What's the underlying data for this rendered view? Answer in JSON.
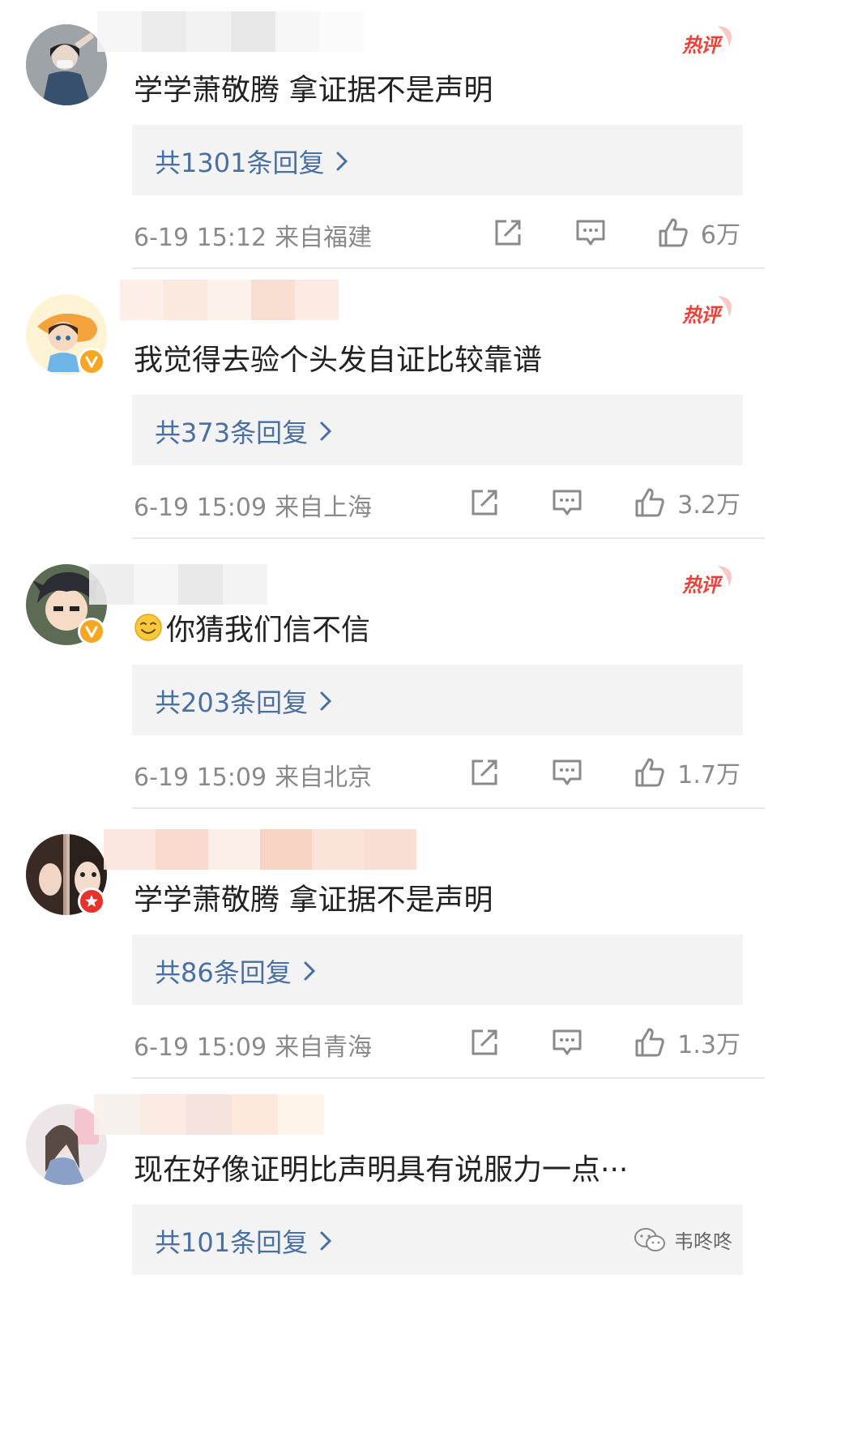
{
  "comments": [
    {
      "text": "学学萧敬腾 拿证据不是声明",
      "hot_label": "热评",
      "reply_label": "共1301条回复",
      "time": "6-19 15:12",
      "location": "来自福建",
      "likes": "6万",
      "verified": "none",
      "has_hot": true
    },
    {
      "text": "我觉得去验个头发自证比较靠谱",
      "hot_label": "热评",
      "reply_label": "共373条回复",
      "time": "6-19 15:09",
      "location": "来自上海",
      "likes": "3.2万",
      "verified": "yellow",
      "has_hot": true
    },
    {
      "text": "你猜我们信不信",
      "hot_label": "热评",
      "reply_label": "共203条回复",
      "time": "6-19 15:09",
      "location": "来自北京",
      "likes": "1.7万",
      "verified": "yellow",
      "has_hot": true
    },
    {
      "text": "学学萧敬腾 拿证据不是声明",
      "reply_label": "共86条回复",
      "time": "6-19 15:09",
      "location": "来自青海",
      "likes": "1.3万",
      "verified": "red",
      "has_hot": false
    },
    {
      "text": "现在好像证明比声明具有说服力一点···",
      "reply_label": "共101条回复",
      "verified": "none",
      "has_hot": false
    }
  ],
  "watermark": {
    "label": "韦咚咚"
  },
  "icons": {
    "share": "share-icon",
    "comment": "comment-icon",
    "like": "thumbs-up-icon",
    "chevron": "chevron-right-icon",
    "emoji": "smiling-emoji-icon"
  },
  "colors": {
    "link": "#4a6fa1",
    "hot": "#e8423a",
    "meta": "#8a8a8a",
    "reply_bg": "#f3f3f3",
    "verify_yellow": "#f5a623",
    "verify_red": "#e5322d"
  }
}
